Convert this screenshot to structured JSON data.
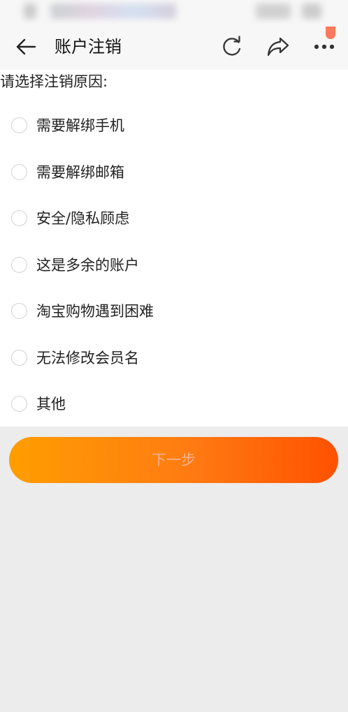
{
  "header": {
    "title": "账户注销",
    "back_icon": "arrow-left-icon",
    "refresh_icon": "refresh-icon",
    "share_icon": "share-icon",
    "more_icon": "more-icon"
  },
  "form": {
    "prompt": "请选择注销原因:",
    "reasons": [
      {
        "label": "需要解绑手机"
      },
      {
        "label": "需要解绑邮箱"
      },
      {
        "label": "安全/隐私顾虑"
      },
      {
        "label": "这是多余的账户"
      },
      {
        "label": "淘宝购物遇到困难"
      },
      {
        "label": "无法修改会员名"
      },
      {
        "label": "其他"
      }
    ]
  },
  "actions": {
    "next_label": "下一步"
  },
  "colors": {
    "accent_start": "#ff9d00",
    "accent_end": "#ff5100",
    "background": "#ececec"
  }
}
